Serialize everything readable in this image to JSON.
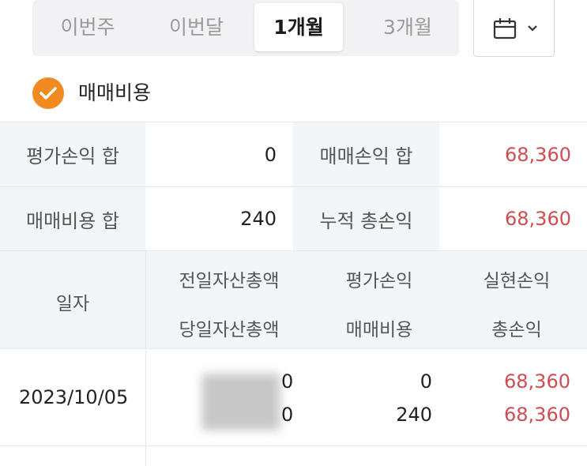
{
  "period_tabs": [
    {
      "label": "이번주",
      "active": false
    },
    {
      "label": "이번달",
      "active": false
    },
    {
      "label": "1개월",
      "active": true
    },
    {
      "label": "3개월",
      "active": false
    }
  ],
  "calendar_button": {
    "icon": "calendar-icon",
    "dropdown_icon": "chevron-down-icon"
  },
  "trading_cost_option": {
    "label": "매매비용",
    "checked": true,
    "color": "#f28a22"
  },
  "summary": {
    "eval_pl_label": "평가손익 합",
    "eval_pl_value": "0",
    "trade_pl_label": "매매손익 합",
    "trade_pl_value": "68,360",
    "trade_cost_label": "매매비용 합",
    "trade_cost_value": "240",
    "cum_total_label": "누적 총손익",
    "cum_total_value": "68,360"
  },
  "table": {
    "headers": {
      "date": "일자",
      "prev_assets": "전일자산총액",
      "today_assets": "당일자산총액",
      "eval_pl": "평가손익",
      "trade_cost": "매매비용",
      "realized_pl": "실현손익",
      "total_pl": "총손익"
    },
    "rows": [
      {
        "date": "2023/10/05",
        "prev_assets_tail": "0",
        "today_assets_tail": "0",
        "eval_pl": "0",
        "trade_cost": "240",
        "realized_pl": "68,360",
        "total_pl": "68,360"
      }
    ]
  },
  "colors": {
    "profit": "#cf4c52",
    "accent": "#f28a22",
    "header_bg": "#f3f6f9"
  }
}
